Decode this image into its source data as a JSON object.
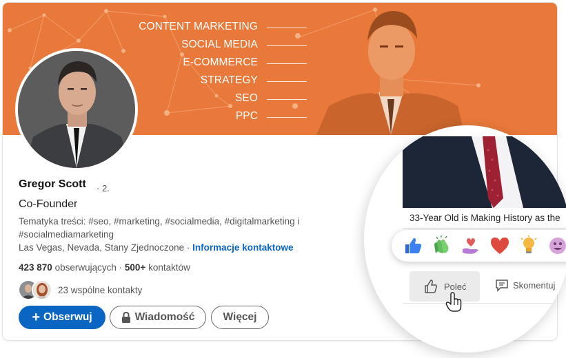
{
  "banner": {
    "topics": [
      "CONTENT MARKETING",
      "SOCIAL MEDIA",
      "E-COMMERCE",
      "STRATEGY",
      "SEO",
      "PPC"
    ],
    "color": "#e8793a"
  },
  "profile": {
    "name": "Gregor Scott",
    "degree": "· 2.",
    "headline": "Co-Founder",
    "tags": "Tematyka treści: #seo, #marketing, #socialmedia, #digitalmarketing i #socialmediamarketing",
    "location": "Las Vegas, Nevada, Stany Zjednoczone ·",
    "contact_link": "Informacje kontaktowe",
    "followers_count": "423 870",
    "followers_label": "obserwujących ·",
    "connections_count": "500+",
    "connections_label": "kontaktów",
    "mutual": "23 wspólne kontakty"
  },
  "buttons": {
    "follow": "Obserwuj",
    "follow_icon": "+",
    "message": "Wiadomość",
    "more": "Więcej"
  },
  "post": {
    "title": "33-Year Old is Making History as the",
    "reactions": [
      "like-icon",
      "celebrate-icon",
      "support-icon",
      "love-icon",
      "insightful-icon",
      "funny-icon"
    ],
    "recommend": "Poleć",
    "comment": "Skomentuj"
  },
  "colors": {
    "accent": "#0a66c2",
    "banner": "#e8793a"
  }
}
